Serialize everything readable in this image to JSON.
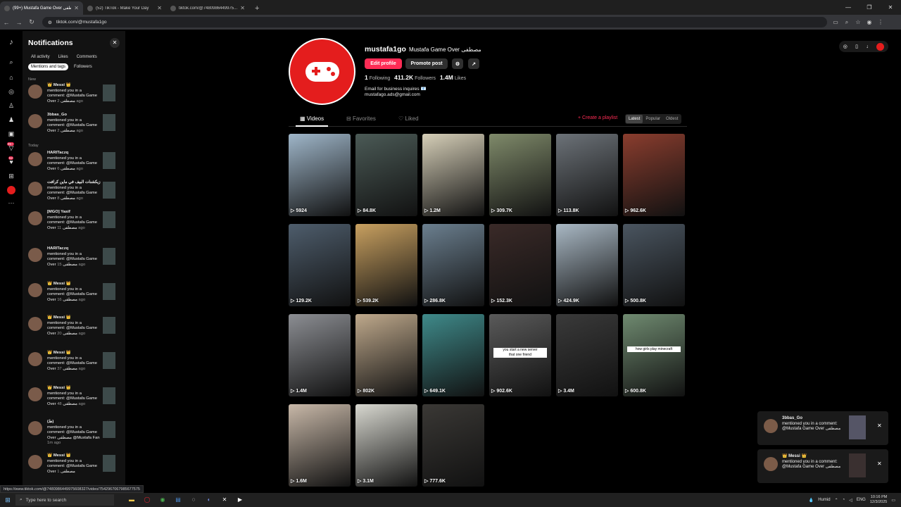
{
  "browser": {
    "tabs": [
      {
        "title": "(99+) Mustafa Game Over مصطفى"
      },
      {
        "title": "(52) TikTok - Make Your Day"
      },
      {
        "title": "tiktok.com/@7480986449975..."
      }
    ],
    "new_tab": "+",
    "url": "tiktok.com/@mustafa1go"
  },
  "rail": {
    "badge_inbox": "99+",
    "badge_activity": "52"
  },
  "notifications": {
    "title": "Notifications",
    "filters": [
      "All activity",
      "Likes",
      "Comments"
    ],
    "filters2": [
      "Mentions and tags",
      "Followers"
    ],
    "section_new": "New",
    "section_today": "Today",
    "items": [
      {
        "name": "👑 Messi 👑",
        "text": "mentioned you in a comment: @Mustafa Game Over مصطفى",
        "time": "2 ago"
      },
      {
        "name": "3bbas_Go",
        "text": "mentioned you in a comment: @Mustafa Game Over مصطفى",
        "time": "2 ago"
      },
      {
        "name": "HARITaczq",
        "text": "mentioned you in a comment: @Mustafa Game Over مصطفى",
        "time": "6 ago"
      },
      {
        "name": "زيكشنات البيف في ماين كرافت",
        "text": "mentioned you in a comment: @Mustafa Game Over مصطفى",
        "time": "8 ago"
      },
      {
        "name": "[MGO] Yasif",
        "text": "mentioned you in a comment: @Mustafa Game Over مصطفى",
        "time": "11 ago"
      },
      {
        "name": "HARITaczq",
        "text": "mentioned you in a comment: @Mustafa Game Over مصطفى",
        "time": "15 ago"
      },
      {
        "name": "👑 Messi 👑",
        "text": "mentioned you in a comment: @Mustafa Game Over مصطفى",
        "time": "16 ago"
      },
      {
        "name": "👑 Messi 👑",
        "text": "mentioned you in a comment: @Mustafa Game Over مصطفى",
        "time": "20 ago"
      },
      {
        "name": "👑 Messi 👑",
        "text": "mentioned you in a comment: @Mustafa Game Over مصطفى",
        "time": "37 ago"
      },
      {
        "name": "👑 Messi 👑",
        "text": "mentioned you in a comment: @Mustafa Game Over مصطفى",
        "time": "48 ago"
      },
      {
        "name": "(ط)",
        "text": "mentioned you in a comment: @Mustafa Game Over مصطفى @Mustafa Fan",
        "time": "1m ago"
      },
      {
        "name": "👑 Messi 👑",
        "text": "mentioned you in a comment: @Mustafa Game Over مصطفى",
        "time": "1"
      }
    ]
  },
  "profile": {
    "username": "mustafa1go",
    "display_name": "Mustafa Game Over مصطفى",
    "edit_profile": "Edit profile",
    "promote_post": "Promote post",
    "following": "1",
    "following_label": "Following",
    "followers": "411.2K",
    "followers_label": "Followers",
    "likes": "1.4M",
    "likes_label": "Likes",
    "bio1": "Email for business inquires 📧",
    "bio2": "mustafago.ads@gmail.com",
    "tabs": [
      "Videos",
      "Favorites",
      "Liked"
    ],
    "create_playlist": "+ Create a playlist",
    "sort": [
      "Latest",
      "Popular",
      "Oldest"
    ]
  },
  "videos": [
    {
      "views": "5924",
      "color": "#9fb6c9"
    },
    {
      "views": "84.8K",
      "color": "#4b5a56"
    },
    {
      "views": "1.2M",
      "color": "#d6cfb8"
    },
    {
      "views": "309.7K",
      "color": "#7f8a6a"
    },
    {
      "views": "113.8K",
      "color": "#6c7278"
    },
    {
      "views": "962.6K",
      "color": "#8a3d2e"
    },
    {
      "views": "129.2K",
      "color": "#4e5d6c"
    },
    {
      "views": "539.2K",
      "color": "#c8a060"
    },
    {
      "views": "286.8K",
      "color": "#6b7f8f"
    },
    {
      "views": "152.3K",
      "color": "#3a2a28"
    },
    {
      "views": "424.9K",
      "color": "#a9b8c4"
    },
    {
      "views": "500.8K",
      "color": "#4a5560"
    },
    {
      "views": "1.4M",
      "color": "#8c8e93"
    },
    {
      "views": "802K",
      "color": "#bfa98c"
    },
    {
      "views": "649.1K",
      "color": "#3f8a8a"
    },
    {
      "views": "902.6K",
      "color": "#5a5a5a"
    },
    {
      "views": "3.4M",
      "color": "#3a3a3a"
    },
    {
      "views": "600.8K",
      "color": "#6f8a70"
    },
    {
      "views": "1.6M",
      "color": "#c8b8a8"
    },
    {
      "views": "3.1M",
      "color": "#d8d8d0"
    },
    {
      "views": "777.6K",
      "color": "#3a3835"
    }
  ],
  "captions": {
    "v16a": "you start a new server",
    "v16b": "that one friend",
    "v18": "how girls play minecraft"
  },
  "toasts": [
    {
      "name": "3bbas_Go",
      "text": "mentioned you in a comment: @Mustafa Game Over مصطفى"
    },
    {
      "name": "👑 Messi 👑",
      "text": "mentioned you in a comment: @Mustafa Game Over مصطفى"
    }
  ],
  "status_url": "https://www.tiktok.com/@7480986449975608327/video/7542967067985677575",
  "taskbar": {
    "search": "Type here to search",
    "weather": "Humid",
    "lang": "ENG",
    "time": "10:16 PM",
    "date": "12/3/2025"
  }
}
